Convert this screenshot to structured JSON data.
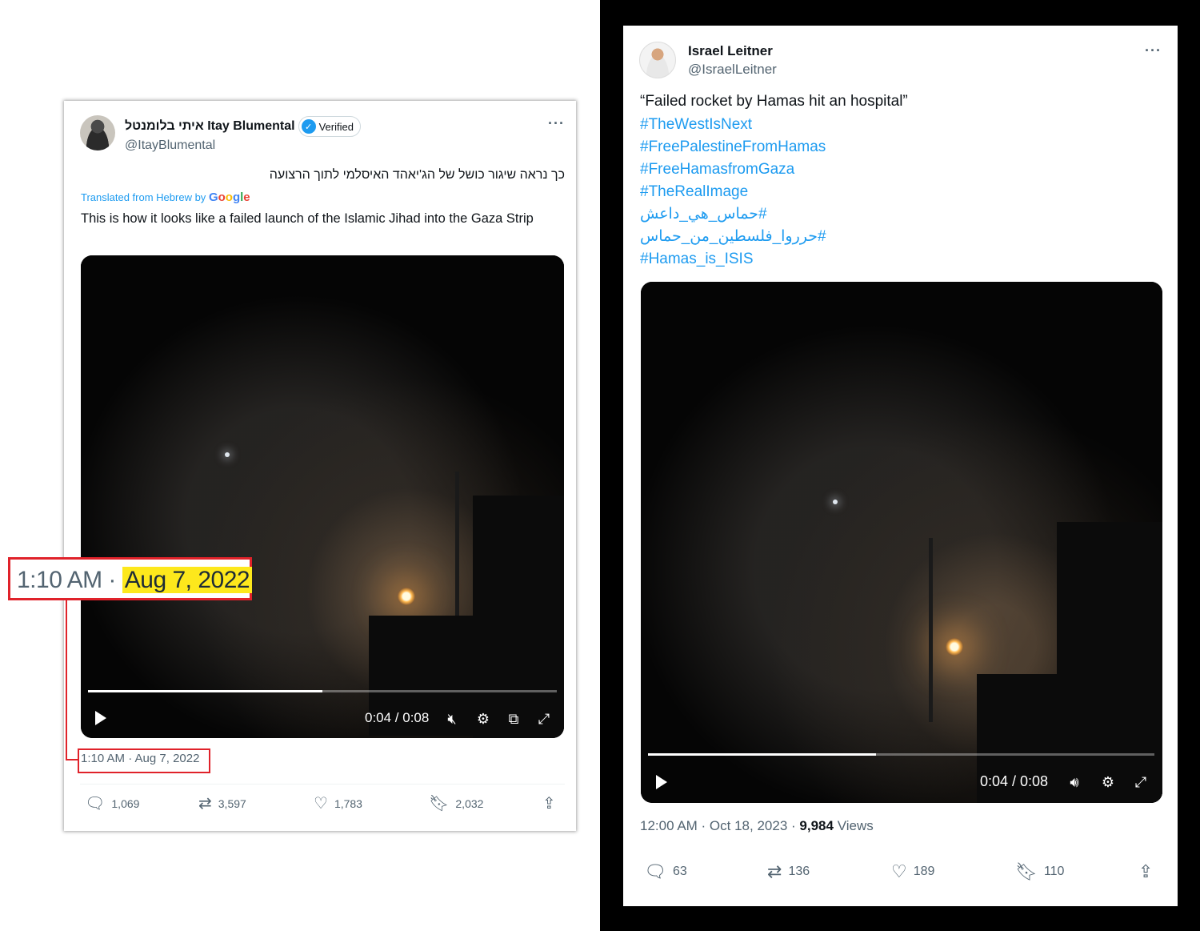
{
  "left_tweet": {
    "author_name": "איתי בלומנטל Itay Blumental",
    "verified_label": "Verified",
    "handle": "@ItayBlumental",
    "more_label": "···",
    "original_text": "כך נראה שיגור כושל של הג'יאהד האיסלמי לתוך הרצועה",
    "translated_prefix": "Translated from Hebrew by",
    "translated_brand": "Google",
    "translation": "This is how it looks like a failed launch of the Islamic Jihad into the Gaza Strip",
    "video": {
      "time": "0:04 / 0:08",
      "progress": 0.5
    },
    "timestamp": "1:10 AM · Aug 7, 2022",
    "actions": {
      "replies": "1,069",
      "reposts": "3,597",
      "likes": "1,783",
      "bookmarks": "2,032"
    }
  },
  "callout": {
    "time": "1:10 AM ·",
    "date": "Aug 7, 2022"
  },
  "right_tweet": {
    "author_name": "Israel Leitner",
    "handle": "@IsraelLeitner",
    "more_label": "···",
    "quote": "“Failed rocket by Hamas hit an hospital”",
    "hashtags": [
      "#TheWestIsNext",
      "#FreePalestineFromHamas",
      "#FreeHamasfromGaza",
      "#TheRealImage",
      "#حماس_هي_داعش",
      "#حرروا_فلسطين_من_حماس",
      "#Hamas_is_ISIS"
    ],
    "video": {
      "time": "0:04 / 0:08",
      "progress": 0.45
    },
    "timestamp": "12:00 AM · Oct 18, 2023 ·",
    "views_count": "9,984",
    "views_label": "Views",
    "actions": {
      "replies": "63",
      "reposts": "136",
      "likes": "189",
      "bookmarks": "110"
    }
  },
  "colors": {
    "accent": "#1d9bf0",
    "annotation_red": "#e0222a",
    "highlight": "#fde81c"
  },
  "icons": [
    "verified-check-icon",
    "more-icon",
    "play-icon",
    "volume-icon",
    "settings-icon",
    "pip-icon",
    "fullscreen-icon",
    "reply-icon",
    "repost-icon",
    "like-icon",
    "bookmark-icon",
    "share-icon"
  ]
}
